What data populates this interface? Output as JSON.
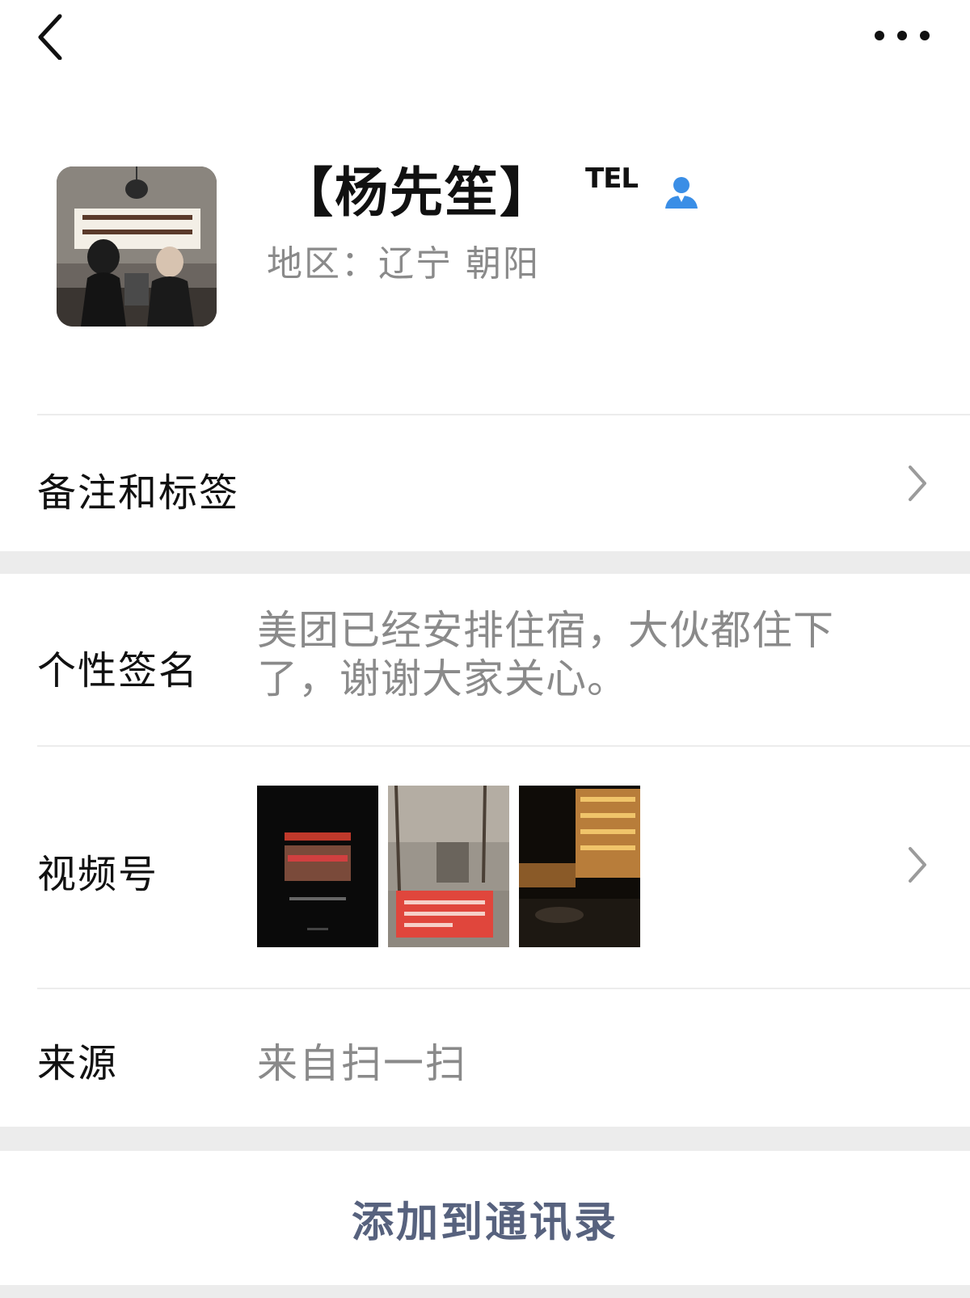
{
  "header": {
    "back_icon": "chevron-left-icon",
    "more_icon": "more-dots-icon"
  },
  "profile": {
    "name": "【杨先笙】",
    "tel_badge": "TEL",
    "contact_icon": "person-icon",
    "contact_icon_color": "#3a8ee6",
    "region": "地区：辽宁 朝阳"
  },
  "rows": {
    "remark": {
      "label": "备注和标签"
    },
    "signature": {
      "label": "个性签名",
      "text": "美团已经安排住宿，大伙都住下了，谢谢大家关心。"
    },
    "channels": {
      "label": "视频号"
    },
    "source": {
      "label": "来源",
      "value": "来自扫一扫"
    }
  },
  "actions": {
    "add_contact": "添加到通讯录",
    "add_contact_color": "#57627e"
  }
}
